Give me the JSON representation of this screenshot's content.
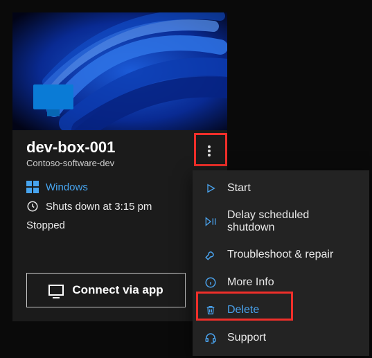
{
  "card": {
    "title": "dev-box-001",
    "subtitle": "Contoso-software-dev",
    "os_label": "Windows",
    "schedule_label": "Shuts down at 3:15 pm",
    "status": "Stopped",
    "connect_label": "Connect via app"
  },
  "menu": {
    "items": [
      {
        "label": "Start"
      },
      {
        "label": "Delay scheduled shutdown"
      },
      {
        "label": "Troubleshoot & repair"
      },
      {
        "label": "More Info"
      },
      {
        "label": "Delete"
      },
      {
        "label": "Support"
      }
    ]
  }
}
